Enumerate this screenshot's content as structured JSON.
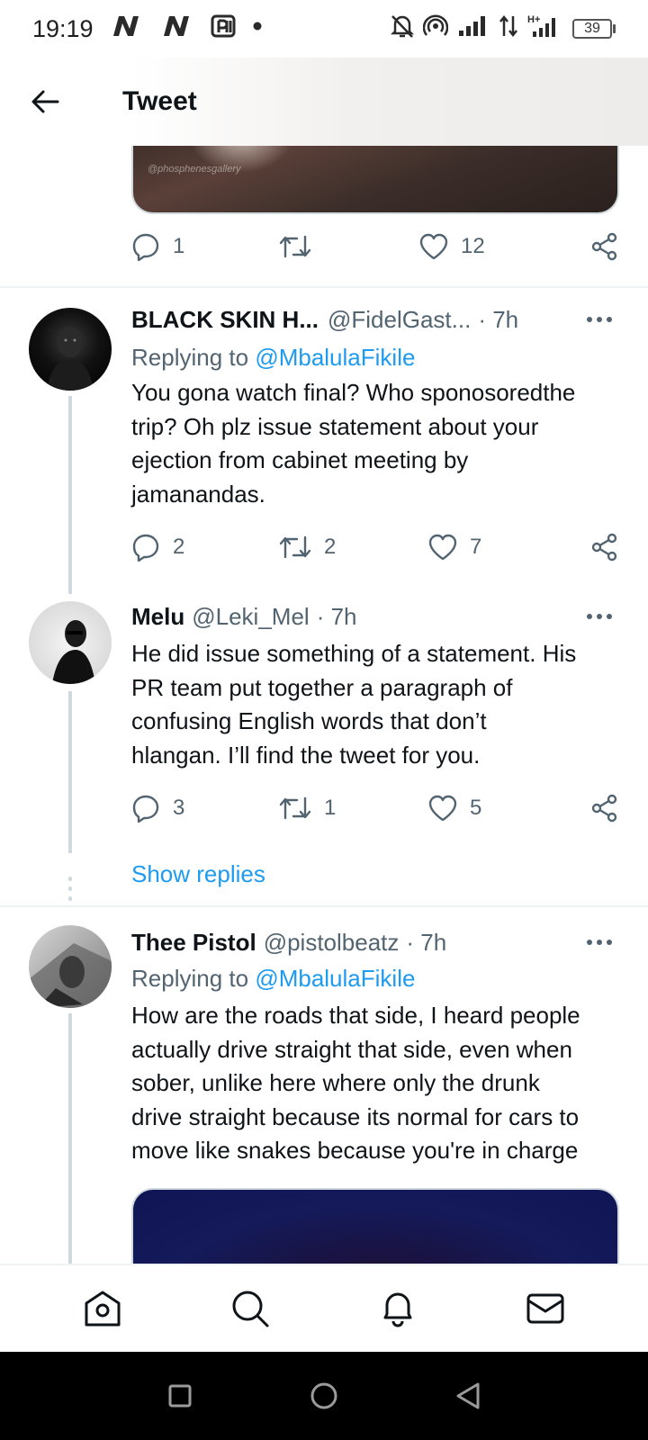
{
  "status_bar": {
    "time": "19:19",
    "battery": "39",
    "left_icons": [
      "netflix-n-icon",
      "netflix-n-icon",
      "app-notification-icon",
      "dot-icon"
    ],
    "right_icons": [
      "mute-icon",
      "hotspot-icon",
      "signal-icon",
      "data-arrows-icon",
      "h-plus-signal-icon",
      "battery-icon"
    ]
  },
  "header": {
    "title": "Tweet",
    "back_icon": "arrow-left-icon"
  },
  "top_tweet": {
    "media_watermark": "@phosphenesgallery",
    "actions": {
      "replies": "1",
      "retweets": "",
      "likes": "12"
    }
  },
  "replies": [
    {
      "name": "BLACK SKIN H...",
      "handle": "@FidelGast...",
      "time": "· 7h",
      "replying_prefix": "Replying to",
      "replying_to": "@MbalulaFikile",
      "text_lines": [
        "You gona watch final? Who sponosoredthe",
        "trip? Oh plz issue statement about your",
        "ejection from cabinet meeting by",
        "jamanandas."
      ],
      "actions": {
        "replies": "2",
        "retweets": "2",
        "likes": "7"
      }
    },
    {
      "name": "Melu",
      "handle": "@Leki_Mel",
      "time": "· 7h",
      "text_lines": [
        "He did issue something of a statement. His",
        "PR team put together a paragraph of",
        "confusing English words that don’t",
        "hlangan. I’ll find the tweet for you."
      ],
      "actions": {
        "replies": "3",
        "retweets": "1",
        "likes": "5"
      }
    },
    {
      "name": "Thee Pistol",
      "handle": "@pistolbeatz",
      "time": "· 7h",
      "replying_prefix": "Replying to",
      "replying_to": "@MbalulaFikile",
      "text_lines": [
        "How are the roads that side, I heard people",
        "actually drive straight that side, even when",
        "sober, unlike here where only the drunk",
        "drive straight because its normal for cars to",
        "move like snakes because you're in charge"
      ]
    }
  ],
  "show_replies": "Show replies",
  "colors": {
    "accent": "#1d9bf0",
    "text": "#0f1419",
    "secondary": "#536471",
    "divider": "#eff3f4"
  }
}
